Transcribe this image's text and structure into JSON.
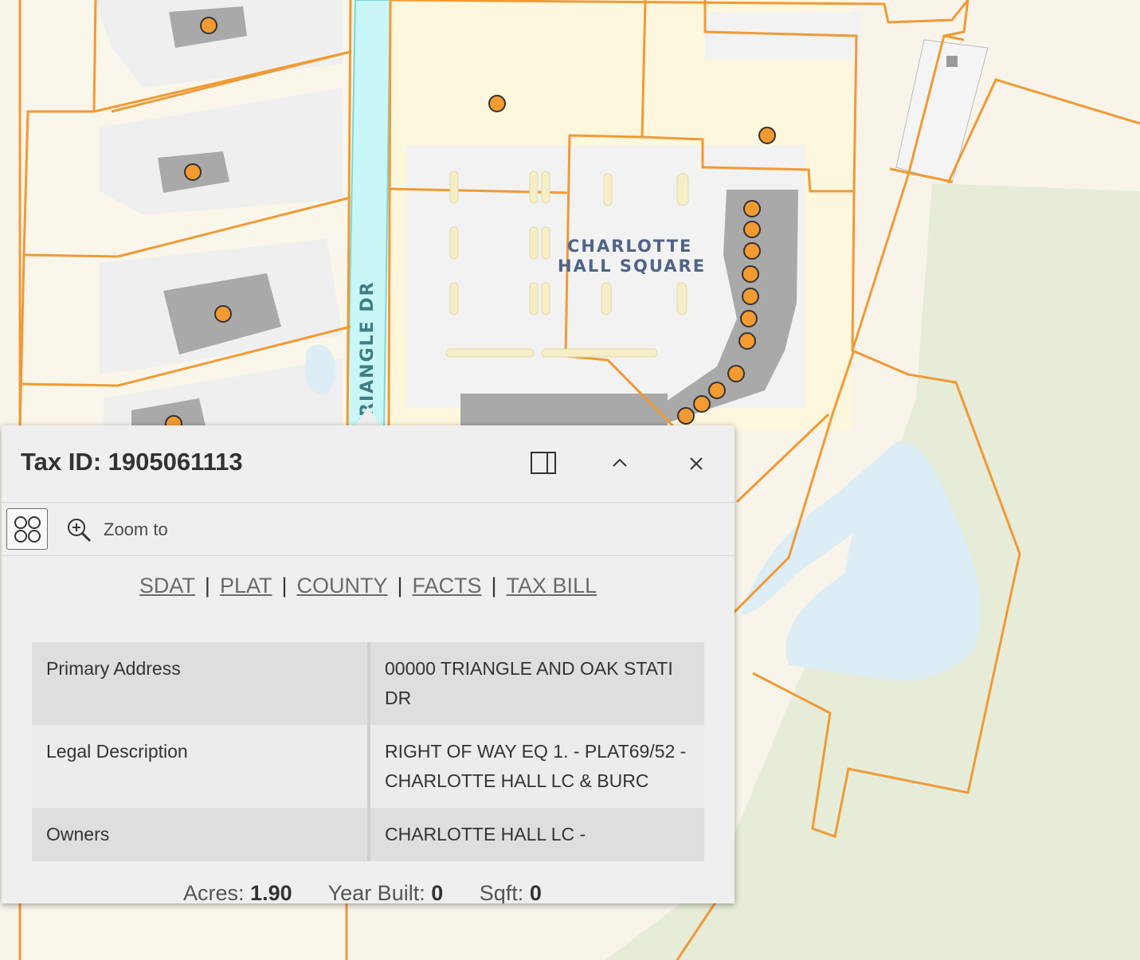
{
  "map": {
    "place_label_line1": "CHARLOTTE",
    "place_label_line2": "HALL SQUARE",
    "road_label": "TRIANGLE DR",
    "colors": {
      "background": "#f7f3ea",
      "parcel_fill": "#fdf7dd",
      "parcel_line": "#f09a36",
      "pavement": "#f2f2f2",
      "building": "#aaaaaa",
      "point": "#f39a31",
      "road": "#c9f6f6",
      "water": "#dcedf6",
      "park": "#e6ecd9"
    }
  },
  "popup": {
    "title": "Tax ID: 1905061113",
    "dock_button": "dock-icon",
    "collapse_button": "chevron-up-icon",
    "close_button": "close-icon",
    "actions": {
      "grid_button": "grid-icon",
      "zoom_label": "Zoom to"
    },
    "links": [
      "SDAT",
      "PLAT",
      "COUNTY",
      "FACTS",
      "TAX BILL"
    ],
    "link_separator": "|",
    "attributes": [
      {
        "label": "Primary Address",
        "value": "00000 TRIANGLE AND OAK STATI DR"
      },
      {
        "label": "Legal Description",
        "value": "RIGHT OF WAY EQ 1. - PLAT69/52 - CHARLOTTE HALL LC & BURC"
      },
      {
        "label": "Owners",
        "value": "CHARLOTTE HALL LC -"
      }
    ],
    "summary": {
      "acres_label": "Acres:",
      "acres_value": "1.90",
      "year_built_label": "Year Built:",
      "year_built_value": "0",
      "sqft_label": "Sqft:",
      "sqft_value": "0"
    }
  }
}
